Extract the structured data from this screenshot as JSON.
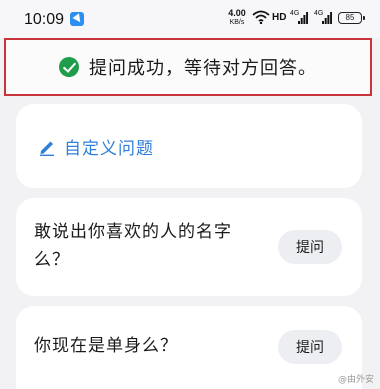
{
  "status_bar": {
    "time": "10:09",
    "net_speed_value": "4.00",
    "net_speed_unit": "KB/s",
    "hd": "HD",
    "signal_1_tag": "4G",
    "signal_2_tag": "4G",
    "battery": "85"
  },
  "toast": {
    "message": "提问成功，等待对方回答。"
  },
  "custom_question": {
    "label": "自定义问题"
  },
  "questions": [
    {
      "text": "敢说出你喜欢的人的名字么？",
      "button": "提问"
    },
    {
      "text": "你现在是单身么？",
      "button": "提问"
    }
  ],
  "watermark": {
    "text": "@由外安"
  },
  "colors": {
    "toast_border": "#c8343c",
    "success_green": "#1f9d4a",
    "accent_blue": "#2f7fd8",
    "page_bg": "#f2f2f4"
  }
}
